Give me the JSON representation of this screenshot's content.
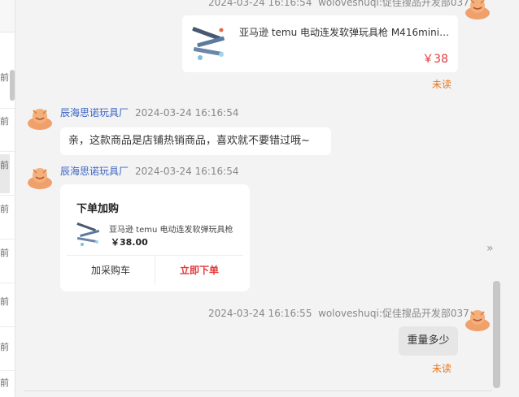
{
  "sidebar": {
    "items": [
      "前",
      "前",
      "前",
      "前",
      "前",
      "前",
      "前",
      "前",
      "前"
    ]
  },
  "messages": [
    {
      "kind": "product",
      "time": "2024-03-24 16:16:54",
      "sender": "woloveshuqi:促佳搜品开发部037",
      "title": "亚马逊 temu 电动连发软弹玩具枪 M416mini跨...",
      "price": "￥38",
      "status": "未读"
    },
    {
      "kind": "text",
      "sender": "辰海思诺玩具厂",
      "time": "2024-03-24 16:16:54",
      "text": "亲，这款商品是店铺热销商品，喜欢就不要错过哦~"
    },
    {
      "kind": "order",
      "sender": "辰海思诺玩具厂",
      "time": "2024-03-24 16:16:54",
      "heading": "下单加购",
      "product_title": "亚马逊 temu 电动连发软弹玩具枪",
      "product_price": "￥38.00",
      "cart_label": "加采购车",
      "buy_label": "立即下单"
    },
    {
      "kind": "self-text",
      "time": "2024-03-24 16:16:55",
      "sender": "woloveshuqi:促佳搜品开发部037",
      "text": "重量多少",
      "status": "未读"
    }
  ],
  "icons": {
    "avatar": "smiling-orange-avatar-icon",
    "collapse": "double-chevron-right-icon"
  },
  "colors": {
    "unread": "#e8771c",
    "price": "#e4393c",
    "sender_name": "#3b63c4"
  }
}
